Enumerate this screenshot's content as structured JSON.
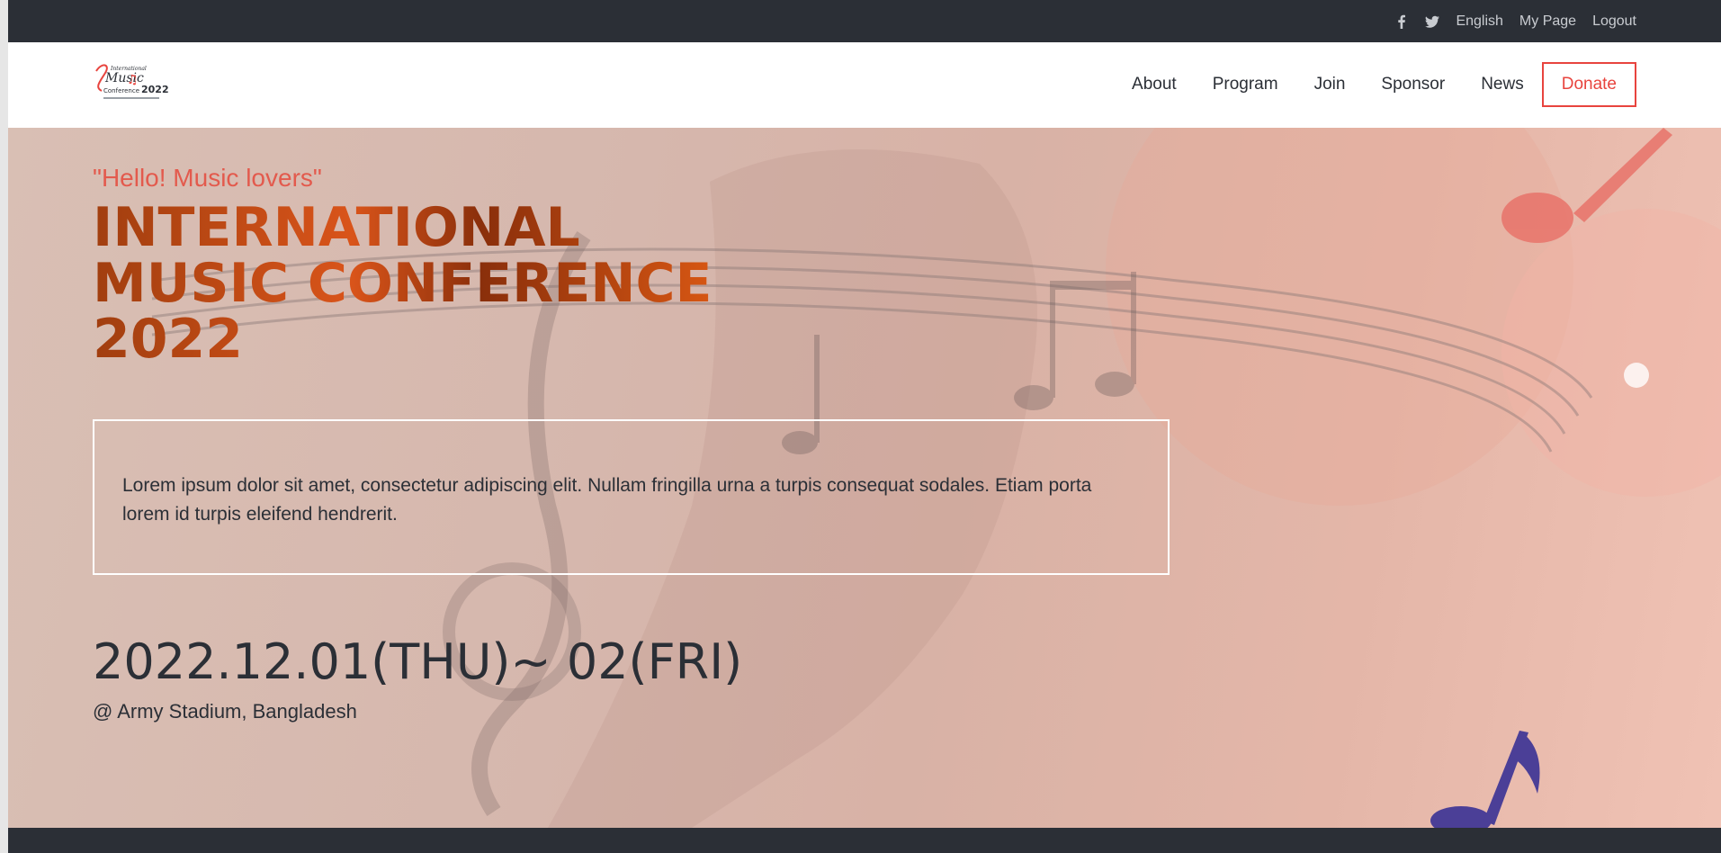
{
  "topbar": {
    "icons": [
      "facebook-icon",
      "twitter-icon"
    ],
    "links": [
      "English",
      "My Page",
      "Logout"
    ]
  },
  "header": {
    "logo": {
      "line1": "International",
      "line2": "Music",
      "line3": "Conference",
      "year": "2022"
    },
    "nav": [
      "About",
      "Program",
      "Join",
      "Sponsor",
      "News"
    ],
    "donate_label": "Donate"
  },
  "hero": {
    "greeting": "\"Hello! Music lovers\"",
    "title_lines": [
      "INTERNATIONAL",
      "MUSIC CONFERENCE",
      "2022"
    ],
    "description": "Lorem ipsum dolor sit amet, consectetur adipiscing elit. Nullam fringilla urna a turpis consequat sodales. Etiam porta lorem id turpis eleifend hendrerit.",
    "date": "2022.12.01(THU)~ 02(FRI)",
    "venue": "@ Army Stadium, Bangladesh"
  },
  "colors": {
    "dark": "#2b2f36",
    "accent": "#e8443e",
    "headline": "#c4501a",
    "note_purple": "#4b3f97"
  }
}
